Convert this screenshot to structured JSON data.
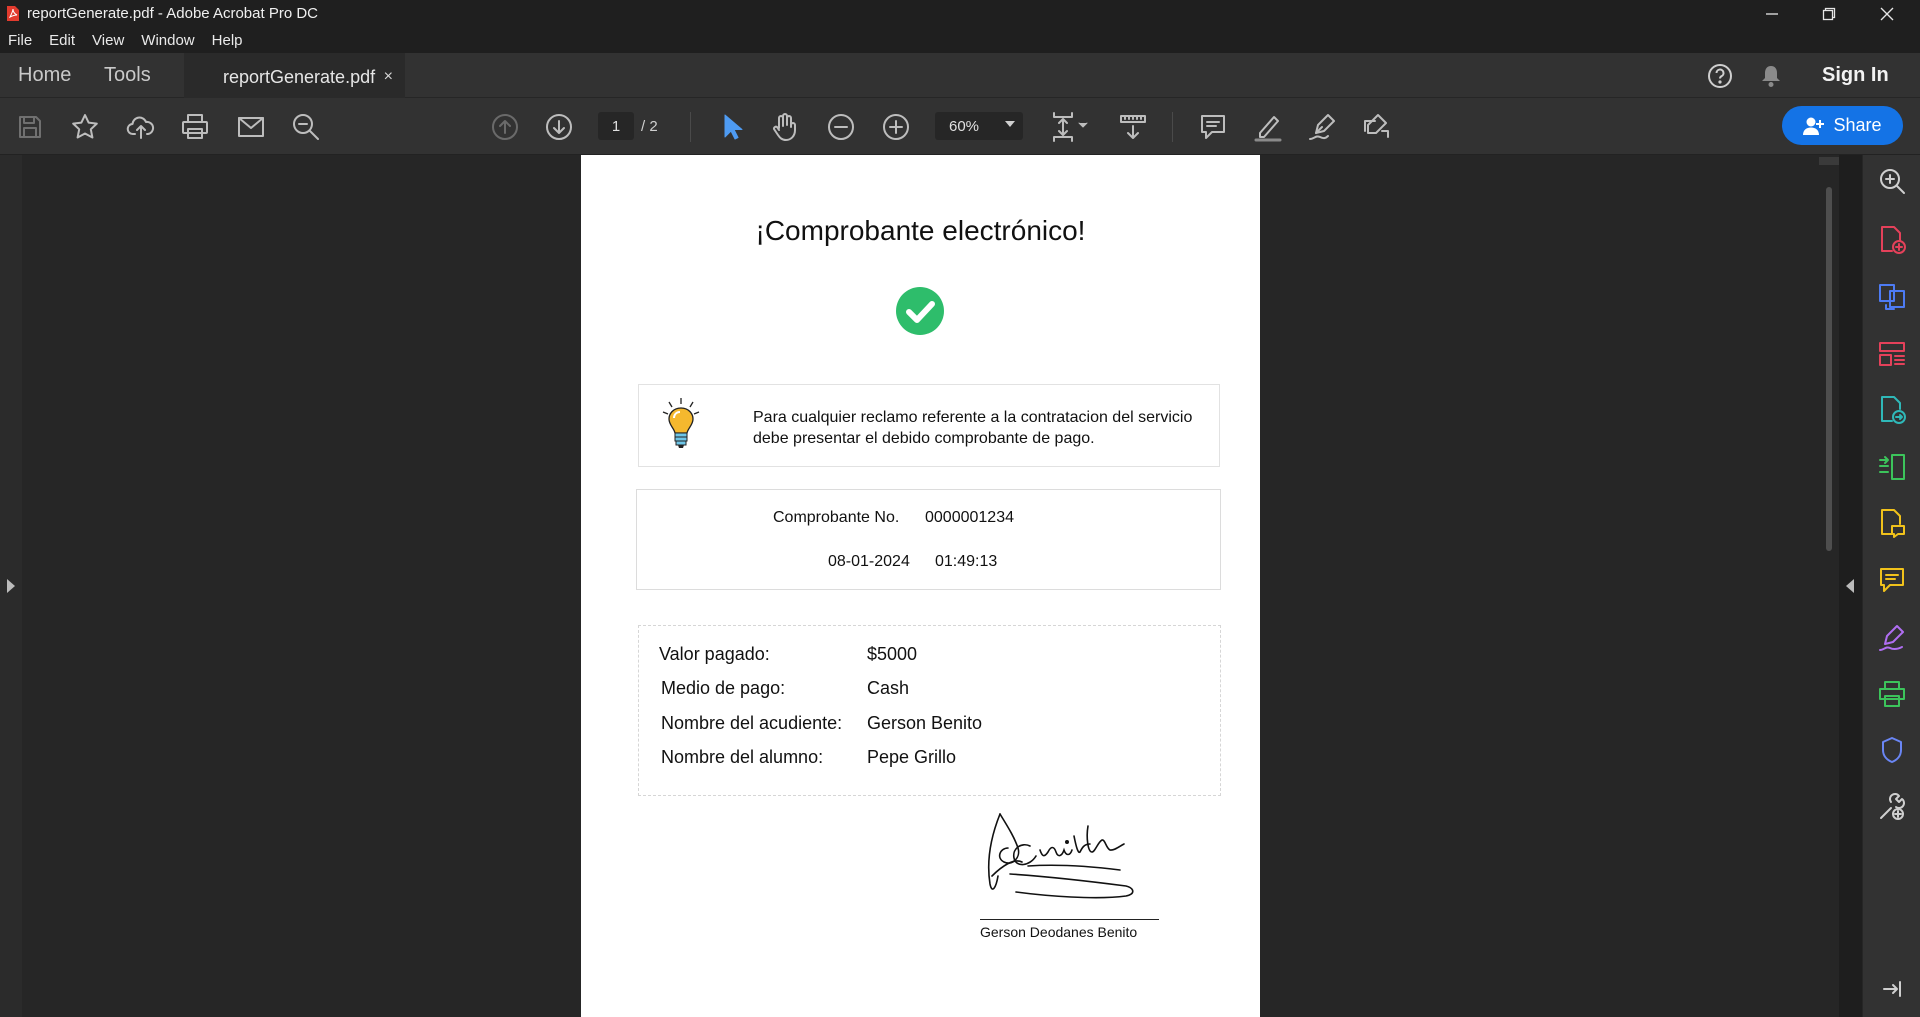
{
  "window": {
    "title": "reportGenerate.pdf - Adobe Acrobat Pro DC"
  },
  "menu": [
    "File",
    "Edit",
    "View",
    "Window",
    "Help"
  ],
  "tabs": {
    "home": "Home",
    "tools": "Tools",
    "document": "reportGenerate.pdf",
    "close": "×",
    "sign_in": "Sign In"
  },
  "toolbar": {
    "current_page": "1",
    "page_total": "/  2",
    "zoom": "60%",
    "share_label": "Share"
  },
  "colors": {
    "share_blue": "#1473e6",
    "check_green": "#2ebd6b",
    "cursor_blue": "#4e9bf2"
  },
  "document": {
    "heading": "¡Comprobante electrónico!",
    "notice": "Para cualquier reclamo referente a la contratacion del servicio debe presentar el debido comprobante de pago.",
    "receipt_label": "Comprobante No.",
    "receipt_number": "0000001234",
    "date": "08-01-2024",
    "time": "01:49:13",
    "details": [
      {
        "label": "Valor pagado:",
        "value": "$5000"
      },
      {
        "label": "Medio de pago:",
        "value": "Cash"
      },
      {
        "label": "Nombre del acudiente:",
        "value": "Gerson Benito"
      },
      {
        "label": "Nombre del alumno:",
        "value": "Pepe Grillo"
      }
    ],
    "signature_name": "Gerson Deodanes Benito"
  },
  "right_panel_icons": [
    "zoom-search-icon",
    "create-pdf-icon",
    "combine-files-icon",
    "organize-pages-icon",
    "export-pdf-icon",
    "compare-files-icon",
    "edit-pdf-icon",
    "comment-icon",
    "fill-sign-icon",
    "scan-ocr-icon",
    "protect-icon",
    "more-tools-icon",
    "collapse-panel-icon"
  ]
}
